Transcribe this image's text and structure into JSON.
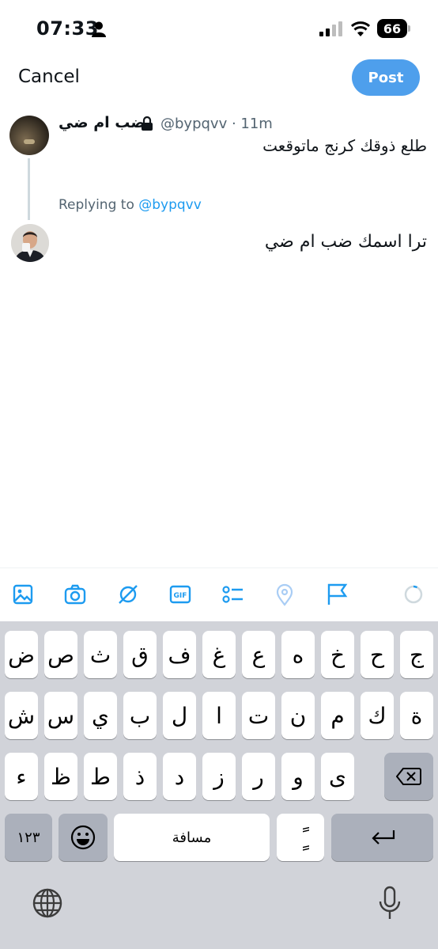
{
  "status_bar": {
    "time": "07:33",
    "battery": "66"
  },
  "header": {
    "cancel_label": "Cancel",
    "post_label": "Post"
  },
  "tweet": {
    "display_name": "ضب ام ضي",
    "handle_time": "@bypqvv · 11m",
    "text": "طلع ذوقك كرنج ماتوقعت"
  },
  "reply": {
    "replying_prefix": "Replying to",
    "replying_handle": "@bypqvv",
    "text": "ترا اسمك ضب ام ضي"
  },
  "toolbar": {
    "icons": [
      "image-icon",
      "camera-icon",
      "grok-icon",
      "gif-icon",
      "poll-icon",
      "location-icon",
      "flag-icon",
      "character-progress-icon"
    ]
  },
  "keyboard": {
    "row1": [
      "ض",
      "ص",
      "ث",
      "ق",
      "ف",
      "غ",
      "ع",
      "ه",
      "خ",
      "ح",
      "ج"
    ],
    "row2": [
      "ش",
      "س",
      "ي",
      "ب",
      "ل",
      "ا",
      "ت",
      "ن",
      "م",
      "ك",
      "ة"
    ],
    "row3": [
      "ء",
      "ظ",
      "ط",
      "ذ",
      "د",
      "ز",
      "ر",
      "و",
      "ى"
    ],
    "numbers_label": "١٢٣",
    "space_label": "مسافة",
    "diacritic_label": "ًٍ"
  },
  "colors": {
    "accent": "#1d9bf0",
    "post_button": "#4e9fec",
    "keyboard_bg": "#d1d3d9"
  }
}
